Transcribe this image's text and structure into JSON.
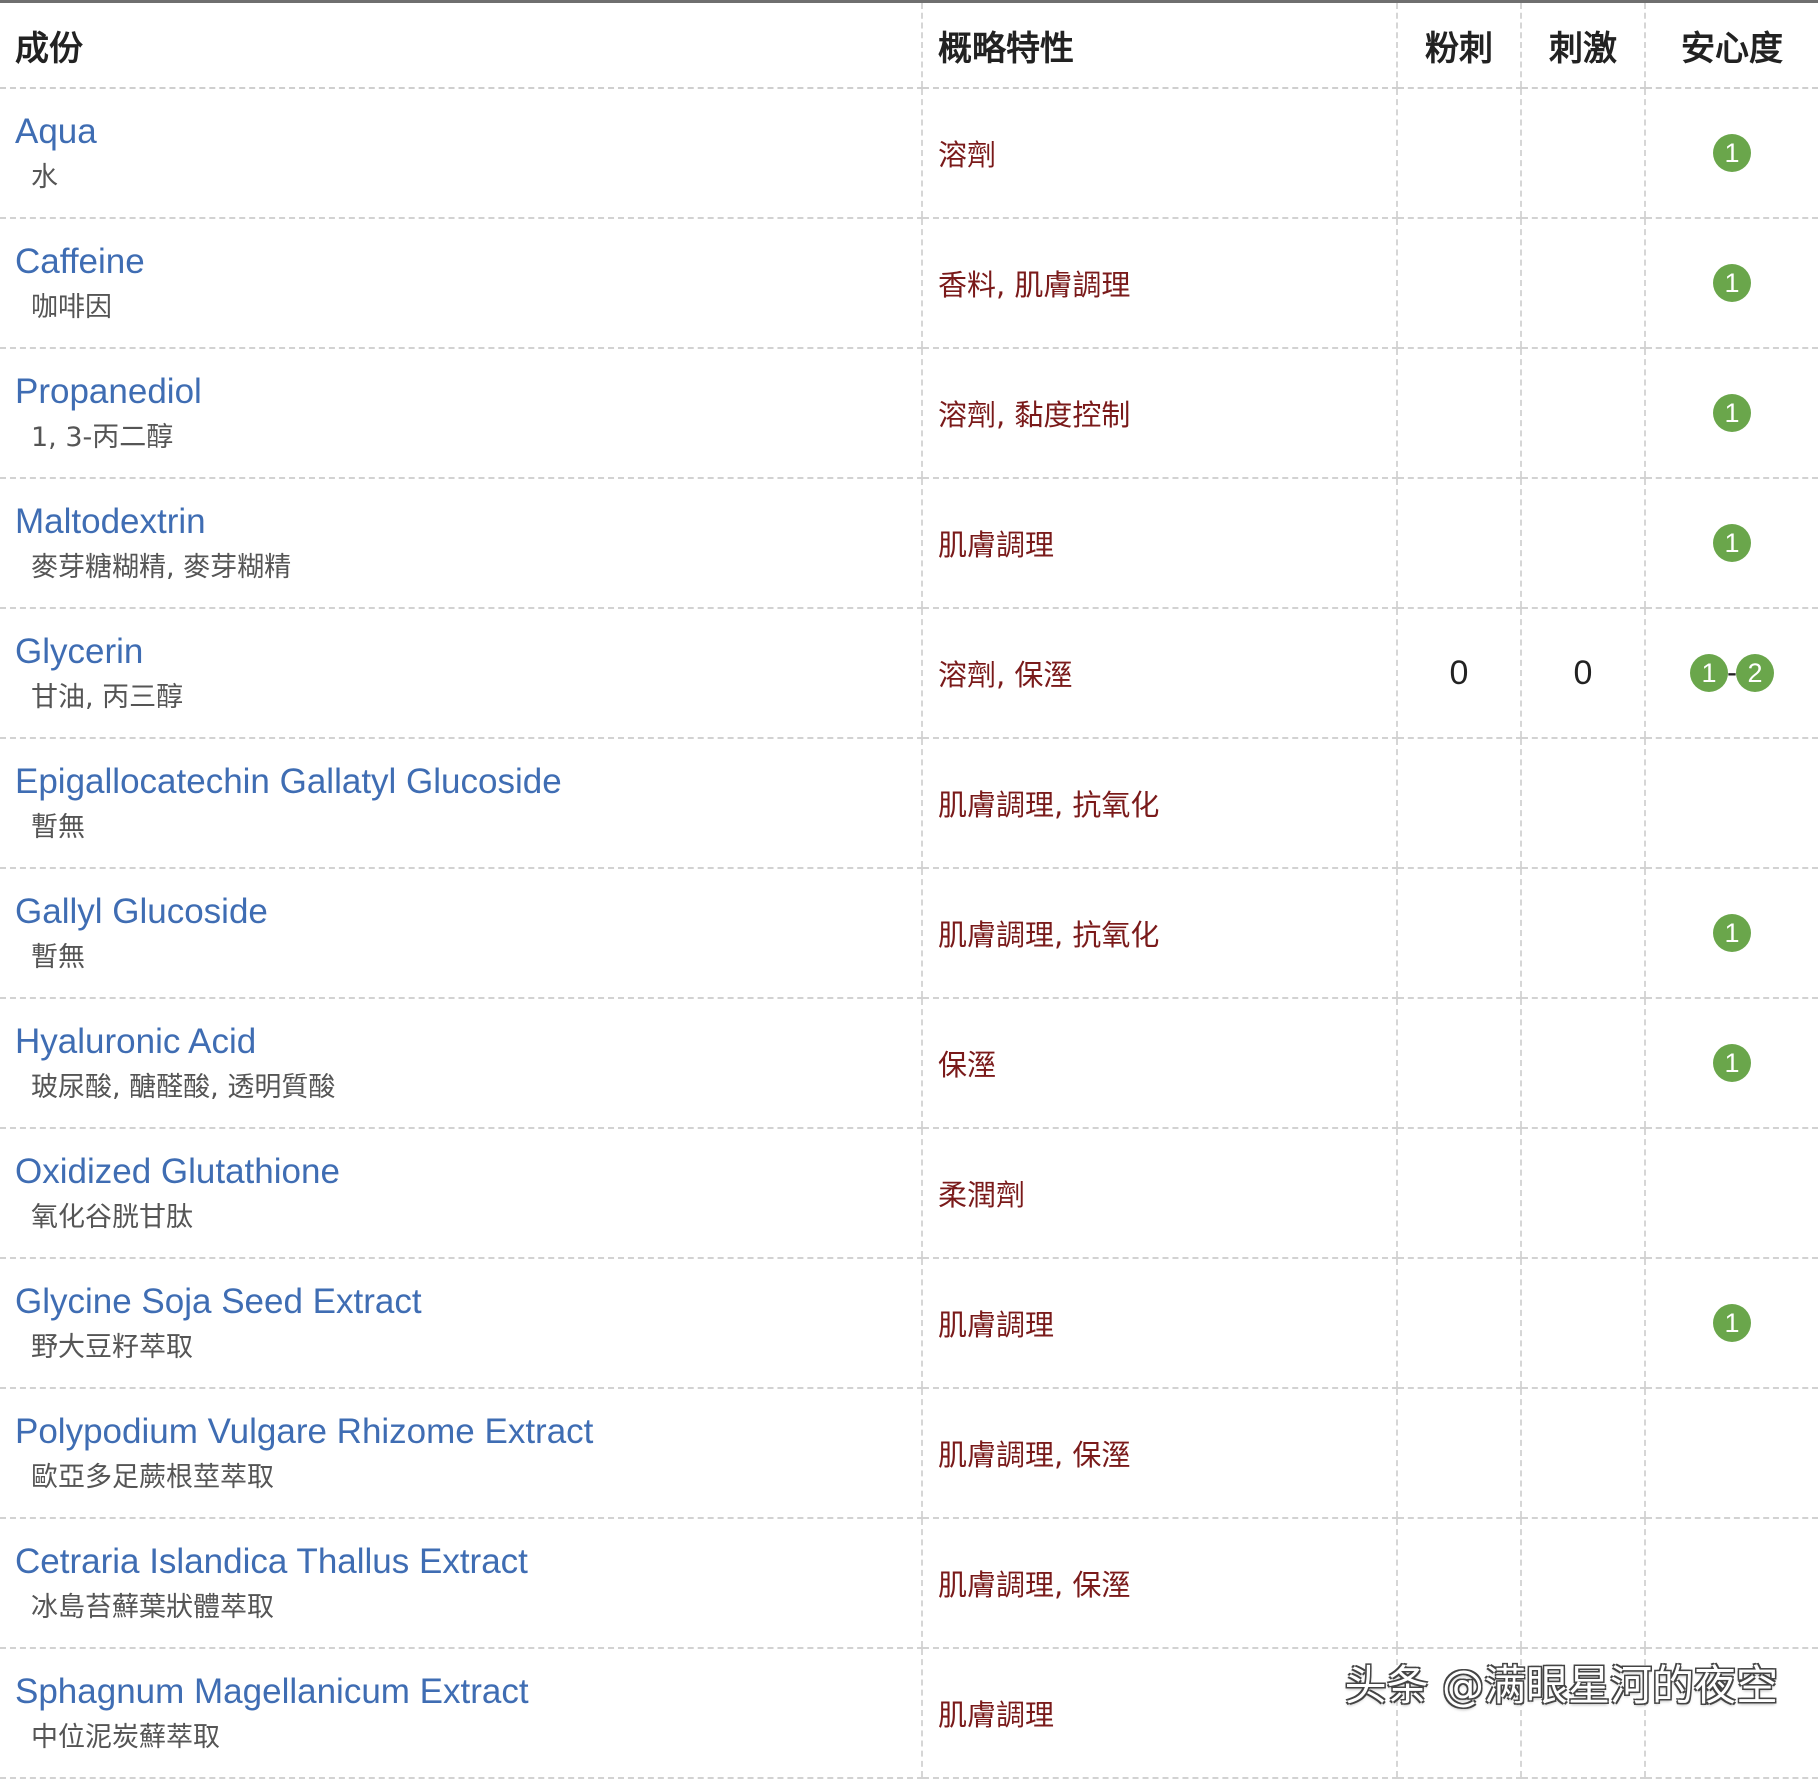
{
  "table": {
    "headers": {
      "ingredient": "成份",
      "properties": "概略特性",
      "acne": "粉刺",
      "irritation": "刺激",
      "safety": "安心度"
    },
    "rows": [
      {
        "en": "Aqua",
        "zh": "水",
        "props": "溶劑",
        "acne": "",
        "irritation": "",
        "safety": [
          "1"
        ]
      },
      {
        "en": "Caffeine",
        "zh": "咖啡因",
        "props": "香料, 肌膚調理",
        "acne": "",
        "irritation": "",
        "safety": [
          "1"
        ]
      },
      {
        "en": "Propanediol",
        "zh": "1, 3-丙二醇",
        "props": "溶劑, 黏度控制",
        "acne": "",
        "irritation": "",
        "safety": [
          "1"
        ]
      },
      {
        "en": "Maltodextrin",
        "zh": "麥芽糖糊精, 麥芽糊精",
        "props": "肌膚調理",
        "acne": "",
        "irritation": "",
        "safety": [
          "1"
        ]
      },
      {
        "en": "Glycerin",
        "zh": "甘油, 丙三醇",
        "props": "溶劑, 保溼",
        "acne": "0",
        "irritation": "0",
        "safety": [
          "1",
          "2"
        ]
      },
      {
        "en": "Epigallocatechin Gallatyl Glucoside",
        "zh": "暫無",
        "props": "肌膚調理, 抗氧化",
        "acne": "",
        "irritation": "",
        "safety": []
      },
      {
        "en": "Gallyl Glucoside",
        "zh": "暫無",
        "props": "肌膚調理, 抗氧化",
        "acne": "",
        "irritation": "",
        "safety": [
          "1"
        ]
      },
      {
        "en": "Hyaluronic Acid",
        "zh": "玻尿酸, 醣醛酸, 透明質酸",
        "props": "保溼",
        "acne": "",
        "irritation": "",
        "safety": [
          "1"
        ]
      },
      {
        "en": "Oxidized Glutathione",
        "zh": "氧化谷胱甘肽",
        "props": "柔潤劑",
        "acne": "",
        "irritation": "",
        "safety": []
      },
      {
        "en": "Glycine Soja Seed Extract",
        "zh": "野大豆籽萃取",
        "props": "肌膚調理",
        "acne": "",
        "irritation": "",
        "safety": [
          "1"
        ]
      },
      {
        "en": "Polypodium Vulgare Rhizome Extract",
        "zh": "歐亞多足蕨根莖萃取",
        "props": "肌膚調理, 保溼",
        "acne": "",
        "irritation": "",
        "safety": []
      },
      {
        "en": "Cetraria Islandica Thallus Extract",
        "zh": "冰島苔蘚葉狀體萃取",
        "props": "肌膚調理, 保溼",
        "acne": "",
        "irritation": "",
        "safety": []
      },
      {
        "en": "Sphagnum Magellanicum Extract",
        "zh": "中位泥炭蘚萃取",
        "props": "肌膚調理",
        "acne": "",
        "irritation": "",
        "safety": []
      }
    ]
  },
  "watermark": "头条 @满眼星河的夜空",
  "colors": {
    "ingredient_link": "#3f6db3",
    "property_text": "#7a1a1a",
    "safety_badge": "#6aa64b"
  }
}
